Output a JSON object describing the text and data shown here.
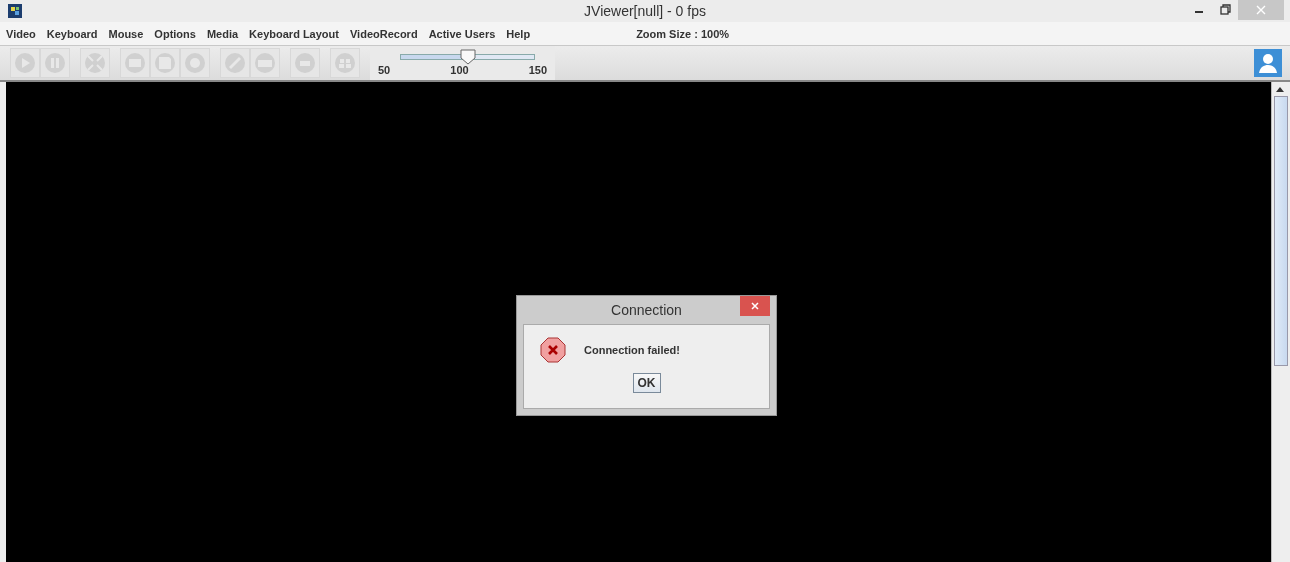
{
  "window": {
    "title": "JViewer[null] - 0 fps"
  },
  "menu": [
    {
      "label": "Video"
    },
    {
      "label": "Keyboard"
    },
    {
      "label": "Mouse"
    },
    {
      "label": "Options"
    },
    {
      "label": "Media"
    },
    {
      "label": "Keyboard Layout"
    },
    {
      "label": "VideoRecord"
    },
    {
      "label": "Active Users"
    },
    {
      "label": "Help"
    }
  ],
  "zoom_label": "Zoom Size : 100%",
  "toolbar": [
    [
      {
        "kind": "play",
        "disabled": true
      },
      {
        "kind": "pause",
        "disabled": true
      }
    ],
    [
      {
        "kind": "fullscreen",
        "disabled": true
      }
    ],
    [
      {
        "kind": "drive",
        "disabled": true
      },
      {
        "kind": "floppy",
        "disabled": true
      },
      {
        "kind": "disc",
        "disabled": true
      }
    ],
    [
      {
        "kind": "mouse",
        "disabled": true
      },
      {
        "kind": "keyboard",
        "disabled": true
      }
    ],
    [
      {
        "kind": "key",
        "disabled": true
      }
    ],
    [
      {
        "kind": "keys",
        "disabled": true
      }
    ]
  ],
  "zoom_slider": {
    "level": 0.5,
    "ticks": [
      "50",
      "100",
      "150"
    ]
  },
  "dialog": {
    "title": "Connection",
    "message": "Connection failed!",
    "button": "OK"
  }
}
